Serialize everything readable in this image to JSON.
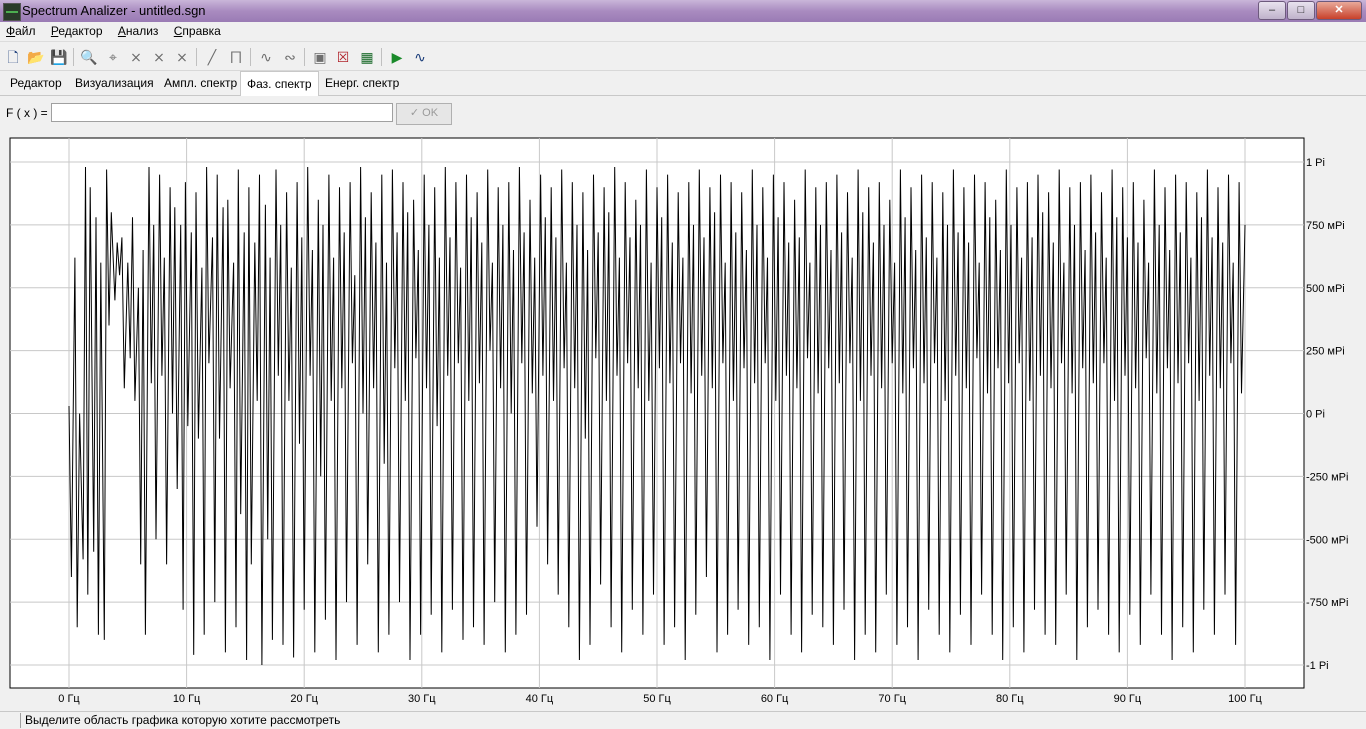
{
  "window": {
    "title": "Spectrum Analizer - untitled.sgn",
    "minimize_glyph": "–",
    "maximize_glyph": "□",
    "close_glyph": "✕"
  },
  "menu": {
    "items": [
      {
        "label": "Файл",
        "underline": "Ф",
        "rest": "айл"
      },
      {
        "label": "Редактор",
        "underline": "Р",
        "rest": "едактор"
      },
      {
        "label": "Анализ",
        "underline": "А",
        "rest": "нализ"
      },
      {
        "label": "Справка",
        "underline": "С",
        "rest": "правка"
      }
    ]
  },
  "toolbar": {
    "icons": [
      {
        "name": "new-file-icon",
        "glyph": "🗋",
        "state": "enabled"
      },
      {
        "name": "open-folder-icon",
        "glyph": "📂",
        "state": "enabled"
      },
      {
        "name": "save-icon",
        "glyph": "💾",
        "state": "enabled"
      },
      {
        "name": "zoom-icon",
        "glyph": "🔍",
        "state": "disabled"
      },
      {
        "name": "crosshair-icon",
        "glyph": "⌖",
        "state": "disabled"
      },
      {
        "name": "filter-low-icon",
        "glyph": "⨯",
        "state": "disabled"
      },
      {
        "name": "filter-high-icon",
        "glyph": "⨯",
        "state": "disabled"
      },
      {
        "name": "filter-band-icon",
        "glyph": "⨯",
        "state": "disabled"
      },
      {
        "name": "line-icon",
        "glyph": "╱",
        "state": "disabled"
      },
      {
        "name": "window-function-icon",
        "glyph": "⨅",
        "state": "disabled"
      },
      {
        "name": "wave-transform-icon",
        "glyph": "∿",
        "state": "disabled"
      },
      {
        "name": "wave-inverse-icon",
        "glyph": "∾",
        "state": "disabled"
      },
      {
        "name": "zoom-region-icon",
        "glyph": "▣",
        "state": "disabled"
      },
      {
        "name": "zoom-cancel-icon",
        "glyph": "☒",
        "state": "enabled"
      },
      {
        "name": "chart-view-icon",
        "glyph": "▦",
        "state": "enabled"
      },
      {
        "name": "play-icon",
        "glyph": "▶",
        "state": "green"
      },
      {
        "name": "signal-icon",
        "glyph": "∿",
        "state": "enabled"
      }
    ]
  },
  "tabs": [
    {
      "label": "Редактор",
      "selected": false
    },
    {
      "label": "Визуализация",
      "selected": false
    },
    {
      "label": "Ампл. спектр",
      "selected": false
    },
    {
      "label": "Фаз. спектр",
      "selected": true
    },
    {
      "label": "Енерг. спектр",
      "selected": false
    }
  ],
  "formula": {
    "label": "F ( x ) =",
    "value": "",
    "ok_label": "✓ OK"
  },
  "chart_data": {
    "type": "line",
    "x_tick_labels": [
      "0 Гц",
      "10 Гц",
      "20 Гц",
      "30 Гц",
      "40 Гц",
      "50 Гц",
      "60 Гц",
      "70 Гц",
      "80 Гц",
      "90 Гц",
      "100 Гц"
    ],
    "y_tick_labels": [
      "1 Pi",
      "750 мPi",
      "500 мPi",
      "250 мPi",
      "0 Pi",
      "-250 мPi",
      "-500 мPi",
      "-750 мPi",
      "-1 Pi"
    ],
    "x_range_hz": [
      0,
      100
    ],
    "y_range_pi": [
      -1,
      1
    ],
    "grid": true,
    "line_color": "#000000",
    "series": [
      {
        "x_hz": [
          0.0,
          0.2,
          0.5,
          0.7,
          0.9,
          1.2,
          1.4,
          1.6,
          1.8,
          2.1,
          2.3,
          2.5,
          2.7,
          3.0,
          3.2,
          3.4,
          3.6,
          3.9,
          4.1,
          4.3,
          4.5,
          4.7,
          5.0,
          5.2,
          5.4,
          5.6,
          5.9,
          6.1,
          6.3,
          6.5,
          6.8,
          7.0,
          7.2,
          7.4,
          7.7,
          7.9,
          8.1,
          8.3,
          8.6,
          8.8,
          9.0,
          9.2,
          9.5,
          9.7,
          9.9,
          10.1,
          10.4,
          10.6,
          10.8,
          11.0,
          11.3,
          11.5,
          11.7,
          11.9,
          12.2,
          12.4,
          12.6,
          12.8,
          13.1,
          13.3,
          13.5,
          13.7,
          14.0,
          14.2,
          14.4,
          14.6,
          14.9,
          15.1,
          15.3,
          15.5,
          15.8,
          16.0,
          16.2,
          16.4,
          16.7,
          16.9,
          17.1,
          17.3,
          17.6,
          17.8,
          18.0,
          18.2,
          18.5,
          18.7,
          18.9,
          19.1,
          19.4,
          19.6,
          19.8,
          20.0,
          20.3,
          20.5,
          20.7,
          20.9,
          21.2,
          21.4,
          21.6,
          21.8,
          22.1,
          22.3,
          22.5,
          22.7,
          23.0,
          23.2,
          23.4,
          23.6,
          23.9,
          24.1,
          24.3,
          24.5,
          24.8,
          25.0,
          25.2,
          25.4,
          25.7,
          25.9,
          26.1,
          26.3,
          26.6,
          26.8,
          27.0,
          27.2,
          27.5,
          27.7,
          27.9,
          28.1,
          28.4,
          28.6,
          28.8,
          29.0,
          29.3,
          29.5,
          29.7,
          29.9,
          30.2,
          30.4,
          30.6,
          30.8,
          31.1,
          31.3,
          31.5,
          31.7,
          32.0,
          32.2,
          32.4,
          32.6,
          32.9,
          33.1,
          33.3,
          33.5,
          33.8,
          34.0,
          34.2,
          34.4,
          34.7,
          34.9,
          35.1,
          35.3,
          35.6,
          35.8,
          36.0,
          36.2,
          36.5,
          36.7,
          36.9,
          37.1,
          37.4,
          37.6,
          37.8,
          38.0,
          38.3,
          38.5,
          38.7,
          38.9,
          39.2,
          39.4,
          39.6,
          39.8,
          40.1,
          40.3,
          40.5,
          40.7,
          41.0,
          41.2,
          41.4,
          41.6,
          41.9,
          42.1,
          42.3,
          42.5,
          42.8,
          43.0,
          43.2,
          43.4,
          43.7,
          43.9,
          44.1,
          44.3,
          44.6,
          44.8,
          45.0,
          45.2,
          45.5,
          45.7,
          45.9,
          46.1,
          46.4,
          46.6,
          46.8,
          47.0,
          47.3,
          47.5,
          47.7,
          47.9,
          48.2,
          48.4,
          48.6,
          48.8,
          49.1,
          49.3,
          49.5,
          49.7,
          50.0,
          50.2,
          50.4,
          50.6,
          50.9,
          51.1,
          51.3,
          51.5,
          51.8,
          52.0,
          52.2,
          52.4,
          52.7,
          52.9,
          53.1,
          53.3,
          53.6,
          53.8,
          54.0,
          54.2,
          54.5,
          54.7,
          54.9,
          55.1,
          55.4,
          55.6,
          55.8,
          56.0,
          56.3,
          56.5,
          56.7,
          56.9,
          57.2,
          57.4,
          57.6,
          57.8,
          58.1,
          58.3,
          58.5,
          58.7,
          59.0,
          59.2,
          59.4,
          59.6,
          59.9,
          60.1,
          60.3,
          60.5,
          60.8,
          61.0,
          61.2,
          61.4,
          61.7,
          61.9,
          62.1,
          62.3,
          62.6,
          62.8,
          63.0,
          63.2,
          63.5,
          63.7,
          63.9,
          64.1,
          64.4,
          64.6,
          64.8,
          65.0,
          65.3,
          65.5,
          65.7,
          65.9,
          66.2,
          66.4,
          66.6,
          66.8,
          67.1,
          67.3,
          67.5,
          67.7,
          68.0,
          68.2,
          68.4,
          68.6,
          68.9,
          69.1,
          69.3,
          69.5,
          69.8,
          70.0,
          70.2,
          70.4,
          70.7,
          70.9,
          71.1,
          71.3,
          71.6,
          71.8,
          72.0,
          72.2,
          72.5,
          72.7,
          72.9,
          73.1,
          73.4,
          73.6,
          73.8,
          74.0,
          74.3,
          74.5,
          74.7,
          74.9,
          75.2,
          75.4,
          75.6,
          75.8,
          76.1,
          76.3,
          76.5,
          76.7,
          77.0,
          77.2,
          77.4,
          77.6,
          77.9,
          78.1,
          78.3,
          78.5,
          78.8,
          79.0,
          79.2,
          79.4,
          79.7,
          79.9,
          80.1,
          80.3,
          80.6,
          80.8,
          81.0,
          81.2,
          81.5,
          81.7,
          81.9,
          82.1,
          82.4,
          82.6,
          82.8,
          83.0,
          83.3,
          83.5,
          83.7,
          83.9,
          84.2,
          84.4,
          84.6,
          84.8,
          85.1,
          85.3,
          85.5,
          85.7,
          86.0,
          86.2,
          86.4,
          86.6,
          86.9,
          87.1,
          87.3,
          87.5,
          87.8,
          88.0,
          88.2,
          88.4,
          88.7,
          88.9,
          89.1,
          89.3,
          89.6,
          89.8,
          90.0,
          90.2,
          90.5,
          90.7,
          90.9,
          91.1,
          91.4,
          91.6,
          91.8,
          92.0,
          92.3,
          92.5,
          92.7,
          92.9,
          93.2,
          93.4,
          93.6,
          93.8,
          94.1,
          94.3,
          94.5,
          94.7,
          95.0,
          95.2,
          95.4,
          95.6,
          95.9,
          96.1,
          96.3,
          96.5,
          96.8,
          97.0,
          97.2,
          97.4,
          97.7,
          97.9,
          98.1,
          98.3,
          98.6,
          98.8,
          99.0,
          99.2,
          99.5,
          99.7,
          100.0
        ],
        "y_pi": [
          0.03,
          -0.65,
          0.62,
          -0.85,
          0.0,
          -0.58,
          0.98,
          -0.72,
          0.9,
          -0.55,
          0.78,
          -0.88,
          0.6,
          -0.9,
          0.97,
          0.35,
          0.8,
          0.45,
          0.68,
          0.55,
          0.7,
          0.1,
          0.6,
          0.22,
          0.78,
          0.05,
          0.5,
          -0.6,
          0.65,
          -0.88,
          0.98,
          0.12,
          0.75,
          -0.5,
          0.95,
          0.15,
          0.62,
          -0.6,
          0.9,
          0.0,
          0.82,
          -0.3,
          0.75,
          -0.78,
          0.92,
          -0.05,
          0.72,
          -0.96,
          0.88,
          -0.1,
          0.58,
          -0.88,
          0.98,
          0.2,
          0.7,
          -0.75,
          0.95,
          -0.1,
          0.82,
          -0.95,
          0.85,
          0.1,
          0.6,
          -0.85,
          0.97,
          -0.4,
          0.72,
          -0.98,
          0.9,
          -0.6,
          0.68,
          0.05,
          0.95,
          -1.0,
          0.83,
          -0.5,
          0.62,
          -0.9,
          0.97,
          0.15,
          0.75,
          -0.92,
          0.88,
          0.05,
          0.58,
          -0.97,
          0.92,
          -0.12,
          0.7,
          -0.78,
          0.98,
          0.15,
          0.65,
          -0.95,
          0.85,
          -0.25,
          0.75,
          -0.82,
          0.95,
          0.05,
          0.62,
          -0.98,
          0.9,
          0.1,
          0.72,
          -0.75,
          0.92,
          0.2,
          0.55,
          -0.92,
          0.98,
          0.0,
          0.78,
          -0.6,
          0.88,
          0.1,
          0.68,
          -0.95,
          0.95,
          -0.2,
          0.6,
          -0.88,
          0.97,
          0.18,
          0.72,
          -0.75,
          0.92,
          0.05,
          0.8,
          -0.98,
          0.85,
          0.22,
          0.65,
          -0.88,
          0.95,
          0.1,
          0.75,
          -0.8,
          0.9,
          -0.05,
          0.62,
          -0.95,
          0.98,
          0.15,
          0.7,
          -0.78,
          0.92,
          0.2,
          0.58,
          -0.9,
          0.95,
          0.05,
          0.78,
          -0.85,
          0.88,
          0.12,
          0.68,
          -0.92,
          0.97,
          0.25,
          0.6,
          -0.75,
          0.9,
          0.1,
          0.75,
          -0.95,
          0.92,
          0.0,
          0.65,
          -0.88,
          0.98,
          0.2,
          0.72,
          -0.8,
          0.85,
          0.08,
          0.62,
          -0.45,
          0.95,
          0.15,
          0.78,
          -0.6,
          0.9,
          0.05,
          0.7,
          -0.72,
          0.97,
          0.18,
          0.6,
          -0.85,
          0.92,
          0.1,
          0.75,
          -0.98,
          0.88,
          -0.1,
          0.65,
          -0.92,
          0.95,
          0.22,
          0.72,
          -0.68,
          0.9,
          0.05,
          0.8,
          -0.85,
          0.98,
          0.15,
          0.62,
          -0.95,
          0.92,
          0.2,
          0.7,
          -0.78,
          0.85,
          0.1,
          0.75,
          -0.88,
          0.97,
          0.05,
          0.6,
          -0.72,
          0.9,
          0.18,
          0.78,
          -0.92,
          0.95,
          0.12,
          0.68,
          -0.85,
          0.88,
          0.2,
          0.62,
          -0.98,
          0.92,
          0.08,
          0.75,
          -0.8,
          0.97,
          0.15,
          0.7,
          -0.65,
          0.9,
          0.1,
          0.8,
          -0.95,
          0.95,
          0.2,
          0.6,
          -0.88,
          0.92,
          0.05,
          0.72,
          -0.78,
          0.88,
          0.18,
          0.65,
          -0.92,
          0.97,
          0.12,
          0.75,
          -0.85,
          0.9,
          0.2,
          0.62,
          -0.98,
          0.95,
          0.05,
          0.78,
          -0.72,
          0.92,
          0.15,
          0.68,
          -0.88,
          0.85,
          0.1,
          0.7,
          -0.95,
          0.97,
          0.22,
          0.6,
          -0.8,
          0.9,
          0.08,
          0.75,
          -0.85,
          0.92,
          0.18,
          0.65,
          -0.92,
          0.95,
          0.12,
          0.72,
          -0.78,
          0.88,
          0.2,
          0.62,
          -0.98,
          0.97,
          0.05,
          0.8,
          -0.88,
          0.9,
          0.15,
          0.68,
          -0.95,
          0.92,
          0.1,
          0.75,
          -0.72,
          0.85,
          0.2,
          0.6,
          -0.92,
          0.97,
          0.08,
          0.78,
          -0.85,
          0.9,
          0.18,
          0.65,
          -0.98,
          0.95,
          0.12,
          0.7,
          -0.78,
          0.92,
          0.2,
          0.62,
          -0.88,
          0.88,
          0.05,
          0.75,
          -0.95,
          0.97,
          0.15,
          0.72,
          -0.8,
          0.9,
          0.1,
          0.68,
          -0.92,
          0.95,
          0.22,
          0.6,
          -0.72,
          0.92,
          0.08,
          0.78,
          -0.88,
          0.85,
          0.18,
          0.65,
          -0.98,
          0.97,
          0.12,
          0.75,
          -0.85,
          0.9,
          0.2,
          0.62,
          -0.95,
          0.92,
          0.05,
          0.7,
          -0.78,
          0.95,
          0.15,
          0.8,
          -0.88,
          0.88,
          0.1,
          0.68,
          -0.92,
          0.97,
          0.2,
          0.6,
          -0.72,
          0.9,
          0.08,
          0.75,
          -0.98,
          0.92,
          0.18,
          0.65,
          -0.85,
          0.95,
          0.12,
          0.72,
          -0.78,
          0.88,
          0.2,
          0.62,
          -0.88,
          0.97,
          0.05,
          0.78,
          -0.95,
          0.9,
          0.15,
          0.7,
          -0.8,
          0.92,
          0.1,
          0.68,
          -0.92,
          0.85,
          0.22,
          0.6,
          -0.72,
          0.97,
          0.08,
          0.75,
          -0.88,
          0.9,
          0.18,
          0.65,
          -0.98,
          0.95,
          0.12,
          0.72,
          -0.85,
          0.92,
          0.2,
          0.62,
          -0.95,
          0.88,
          0.05,
          0.78,
          -0.78,
          0.97,
          0.15,
          0.7,
          -0.88,
          0.9,
          0.1,
          0.68,
          -0.72,
          0.95,
          0.2,
          0.6,
          -0.92,
          0.92,
          0.08,
          0.75,
          -0.85,
          0.88,
          0.18,
          0.65,
          -0.98,
          0.97,
          0.12,
          0.72,
          -0.78,
          0.9,
          0.5
        ]
      }
    ]
  },
  "status": {
    "text": "Выделите область графика которую хотите рассмотреть"
  }
}
